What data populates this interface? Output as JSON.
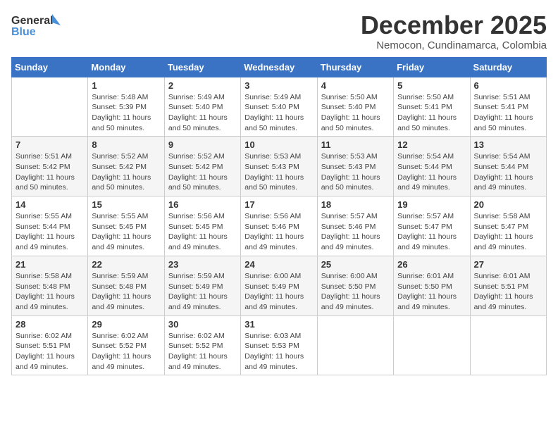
{
  "logo": {
    "line1": "General",
    "line2": "Blue"
  },
  "title": "December 2025",
  "subtitle": "Nemocon, Cundinamarca, Colombia",
  "days_header": [
    "Sunday",
    "Monday",
    "Tuesday",
    "Wednesday",
    "Thursday",
    "Friday",
    "Saturday"
  ],
  "weeks": [
    [
      {
        "day": "",
        "info": ""
      },
      {
        "day": "1",
        "info": "Sunrise: 5:48 AM\nSunset: 5:39 PM\nDaylight: 11 hours\nand 50 minutes."
      },
      {
        "day": "2",
        "info": "Sunrise: 5:49 AM\nSunset: 5:40 PM\nDaylight: 11 hours\nand 50 minutes."
      },
      {
        "day": "3",
        "info": "Sunrise: 5:49 AM\nSunset: 5:40 PM\nDaylight: 11 hours\nand 50 minutes."
      },
      {
        "day": "4",
        "info": "Sunrise: 5:50 AM\nSunset: 5:40 PM\nDaylight: 11 hours\nand 50 minutes."
      },
      {
        "day": "5",
        "info": "Sunrise: 5:50 AM\nSunset: 5:41 PM\nDaylight: 11 hours\nand 50 minutes."
      },
      {
        "day": "6",
        "info": "Sunrise: 5:51 AM\nSunset: 5:41 PM\nDaylight: 11 hours\nand 50 minutes."
      }
    ],
    [
      {
        "day": "7",
        "info": "Sunrise: 5:51 AM\nSunset: 5:42 PM\nDaylight: 11 hours\nand 50 minutes."
      },
      {
        "day": "8",
        "info": "Sunrise: 5:52 AM\nSunset: 5:42 PM\nDaylight: 11 hours\nand 50 minutes."
      },
      {
        "day": "9",
        "info": "Sunrise: 5:52 AM\nSunset: 5:42 PM\nDaylight: 11 hours\nand 50 minutes."
      },
      {
        "day": "10",
        "info": "Sunrise: 5:53 AM\nSunset: 5:43 PM\nDaylight: 11 hours\nand 50 minutes."
      },
      {
        "day": "11",
        "info": "Sunrise: 5:53 AM\nSunset: 5:43 PM\nDaylight: 11 hours\nand 50 minutes."
      },
      {
        "day": "12",
        "info": "Sunrise: 5:54 AM\nSunset: 5:44 PM\nDaylight: 11 hours\nand 49 minutes."
      },
      {
        "day": "13",
        "info": "Sunrise: 5:54 AM\nSunset: 5:44 PM\nDaylight: 11 hours\nand 49 minutes."
      }
    ],
    [
      {
        "day": "14",
        "info": "Sunrise: 5:55 AM\nSunset: 5:44 PM\nDaylight: 11 hours\nand 49 minutes."
      },
      {
        "day": "15",
        "info": "Sunrise: 5:55 AM\nSunset: 5:45 PM\nDaylight: 11 hours\nand 49 minutes."
      },
      {
        "day": "16",
        "info": "Sunrise: 5:56 AM\nSunset: 5:45 PM\nDaylight: 11 hours\nand 49 minutes."
      },
      {
        "day": "17",
        "info": "Sunrise: 5:56 AM\nSunset: 5:46 PM\nDaylight: 11 hours\nand 49 minutes."
      },
      {
        "day": "18",
        "info": "Sunrise: 5:57 AM\nSunset: 5:46 PM\nDaylight: 11 hours\nand 49 minutes."
      },
      {
        "day": "19",
        "info": "Sunrise: 5:57 AM\nSunset: 5:47 PM\nDaylight: 11 hours\nand 49 minutes."
      },
      {
        "day": "20",
        "info": "Sunrise: 5:58 AM\nSunset: 5:47 PM\nDaylight: 11 hours\nand 49 minutes."
      }
    ],
    [
      {
        "day": "21",
        "info": "Sunrise: 5:58 AM\nSunset: 5:48 PM\nDaylight: 11 hours\nand 49 minutes."
      },
      {
        "day": "22",
        "info": "Sunrise: 5:59 AM\nSunset: 5:48 PM\nDaylight: 11 hours\nand 49 minutes."
      },
      {
        "day": "23",
        "info": "Sunrise: 5:59 AM\nSunset: 5:49 PM\nDaylight: 11 hours\nand 49 minutes."
      },
      {
        "day": "24",
        "info": "Sunrise: 6:00 AM\nSunset: 5:49 PM\nDaylight: 11 hours\nand 49 minutes."
      },
      {
        "day": "25",
        "info": "Sunrise: 6:00 AM\nSunset: 5:50 PM\nDaylight: 11 hours\nand 49 minutes."
      },
      {
        "day": "26",
        "info": "Sunrise: 6:01 AM\nSunset: 5:50 PM\nDaylight: 11 hours\nand 49 minutes."
      },
      {
        "day": "27",
        "info": "Sunrise: 6:01 AM\nSunset: 5:51 PM\nDaylight: 11 hours\nand 49 minutes."
      }
    ],
    [
      {
        "day": "28",
        "info": "Sunrise: 6:02 AM\nSunset: 5:51 PM\nDaylight: 11 hours\nand 49 minutes."
      },
      {
        "day": "29",
        "info": "Sunrise: 6:02 AM\nSunset: 5:52 PM\nDaylight: 11 hours\nand 49 minutes."
      },
      {
        "day": "30",
        "info": "Sunrise: 6:02 AM\nSunset: 5:52 PM\nDaylight: 11 hours\nand 49 minutes."
      },
      {
        "day": "31",
        "info": "Sunrise: 6:03 AM\nSunset: 5:53 PM\nDaylight: 11 hours\nand 49 minutes."
      },
      {
        "day": "",
        "info": ""
      },
      {
        "day": "",
        "info": ""
      },
      {
        "day": "",
        "info": ""
      }
    ]
  ]
}
